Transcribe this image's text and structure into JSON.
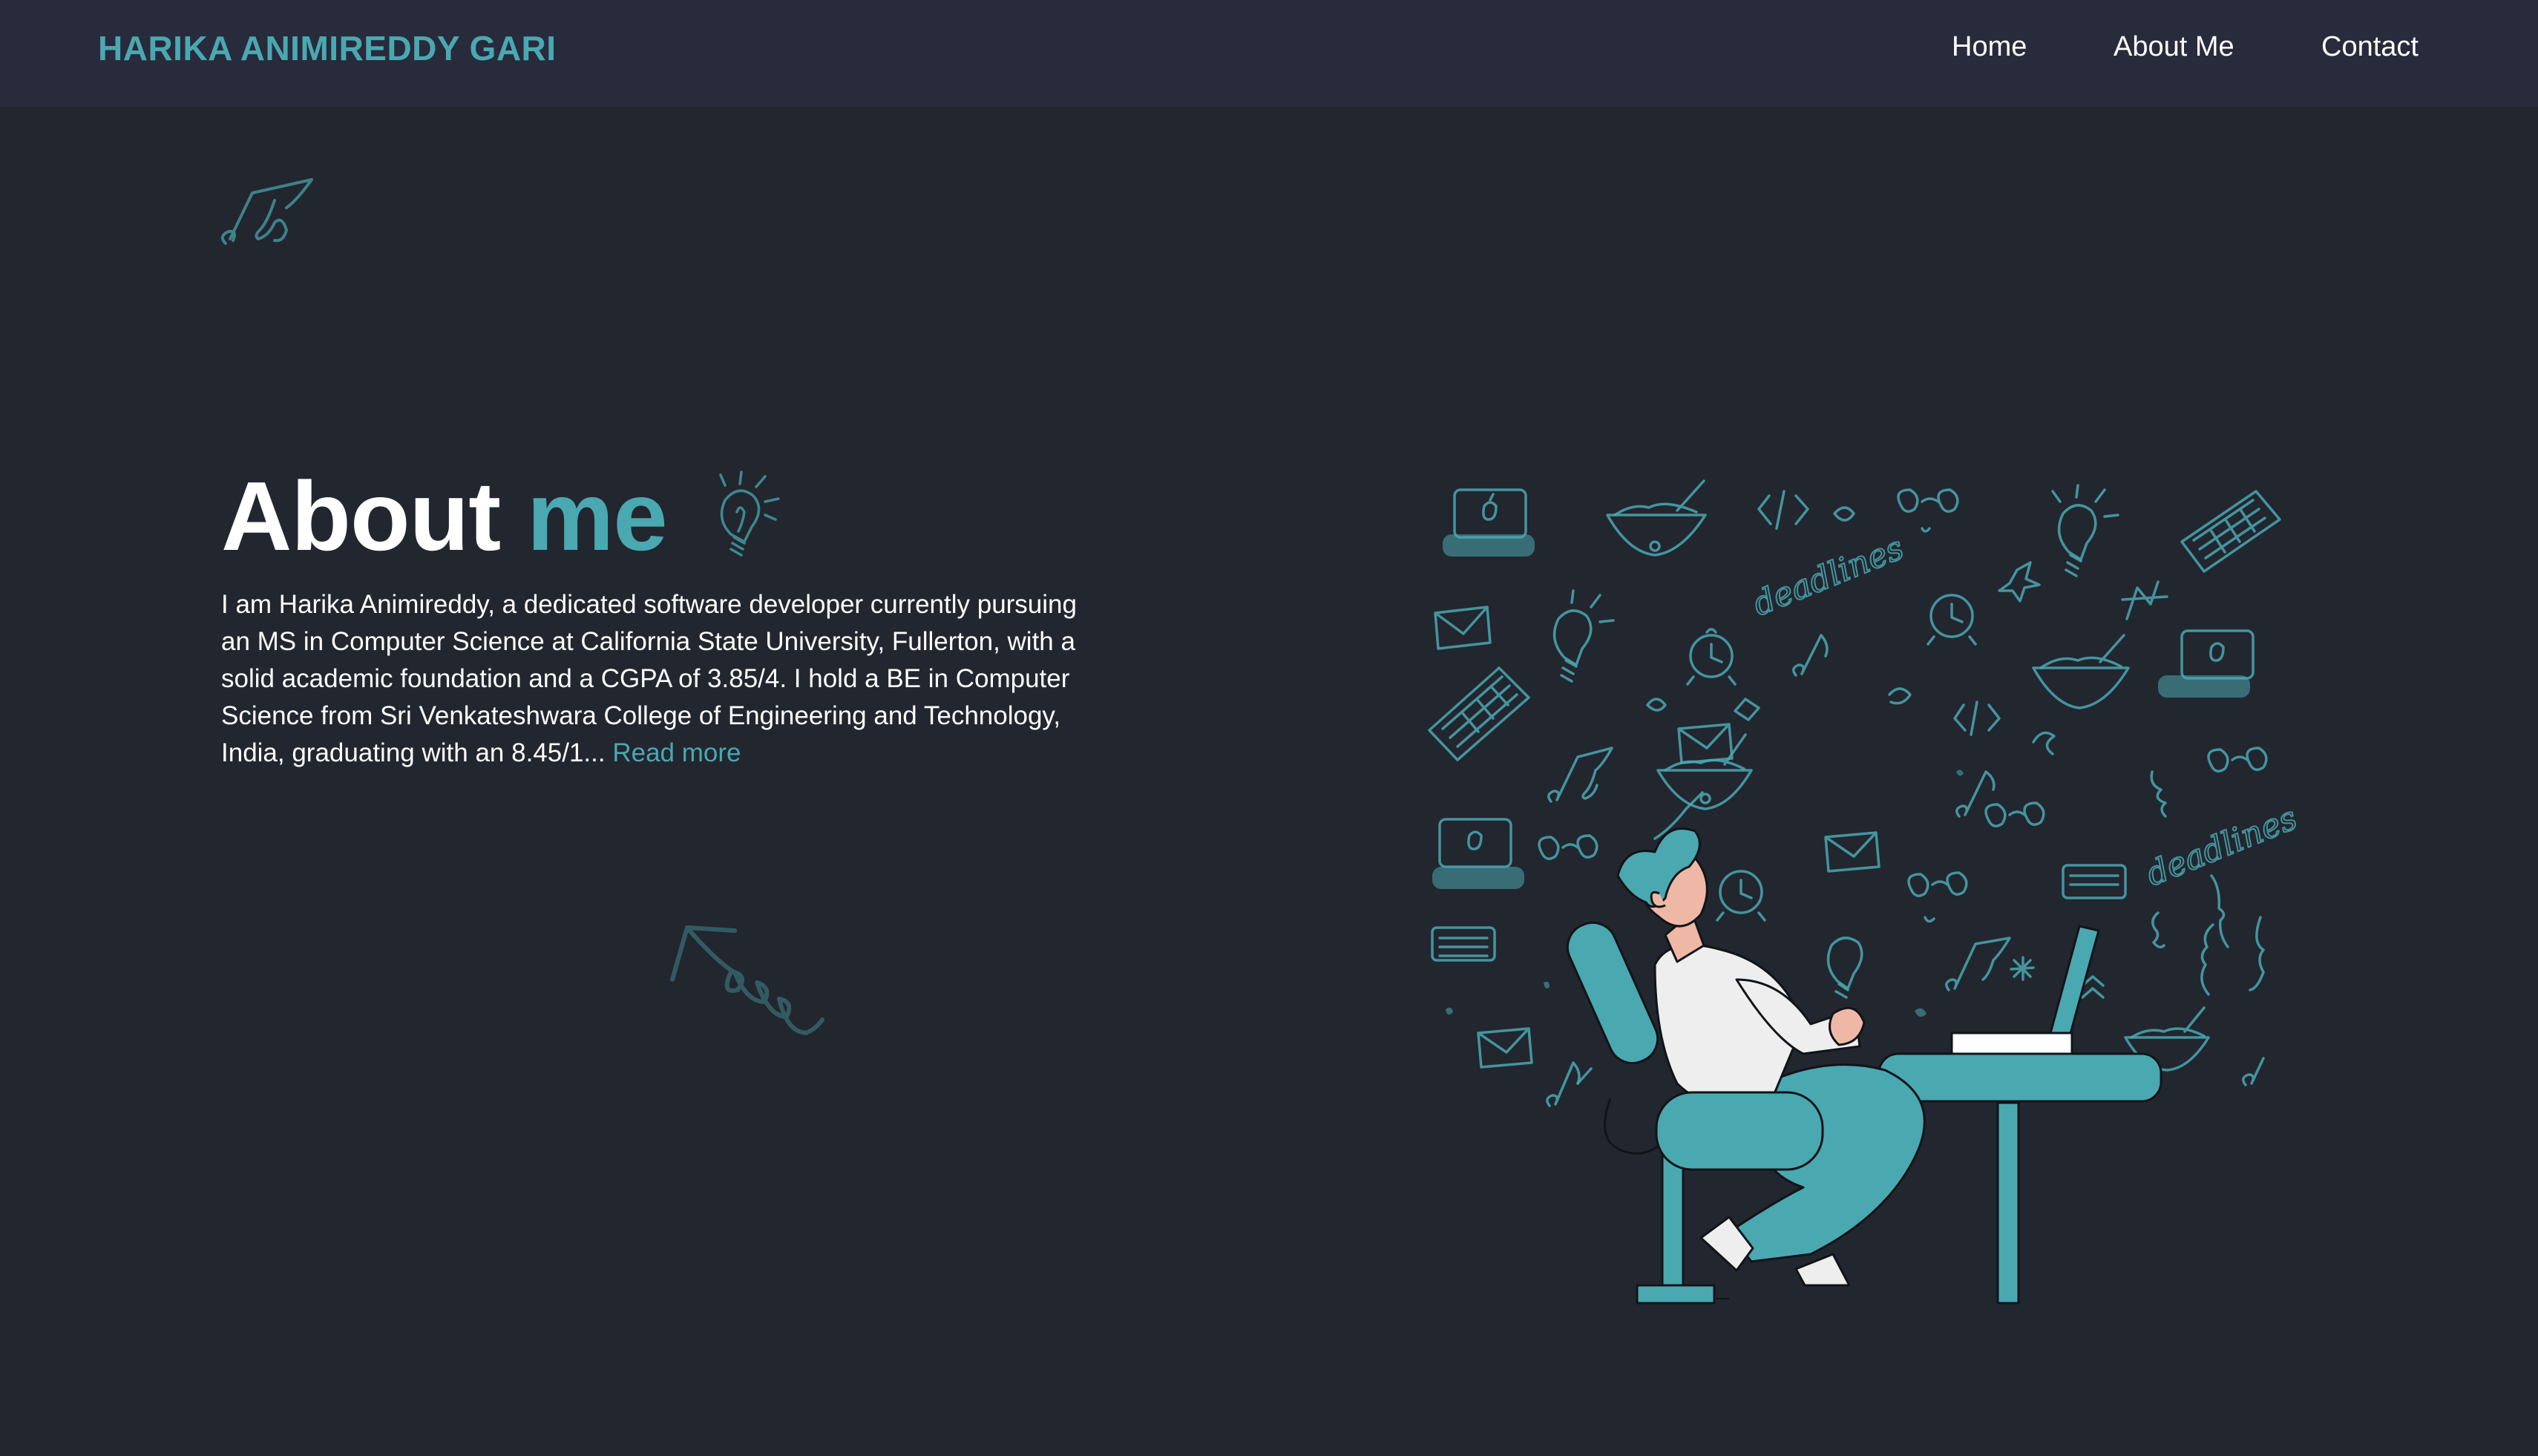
{
  "header": {
    "brand": "HARIKA ANIMIREDDY GARI",
    "nav": {
      "home": "Home",
      "about": "About Me",
      "contact": "Contact"
    }
  },
  "about": {
    "title_plain": "About",
    "title_accent": "me",
    "bio": "I am Harika Animireddy, a dedicated software developer currently pursuing an MS in Computer Science at California State University, Fullerton, with a solid academic foundation and a CGPA of 3.85/4. I hold a BE in Computer Science from Sri Venkateshwara College of Engineering and Technology, India, graduating with an 8.45/1...",
    "read_more": "Read more"
  },
  "illustration": {
    "doodle_word": "deadlines"
  },
  "colors": {
    "background": "#22262f",
    "navbar": "#282b3b",
    "accent": "#4aa8b1",
    "text": "#ffffff"
  }
}
